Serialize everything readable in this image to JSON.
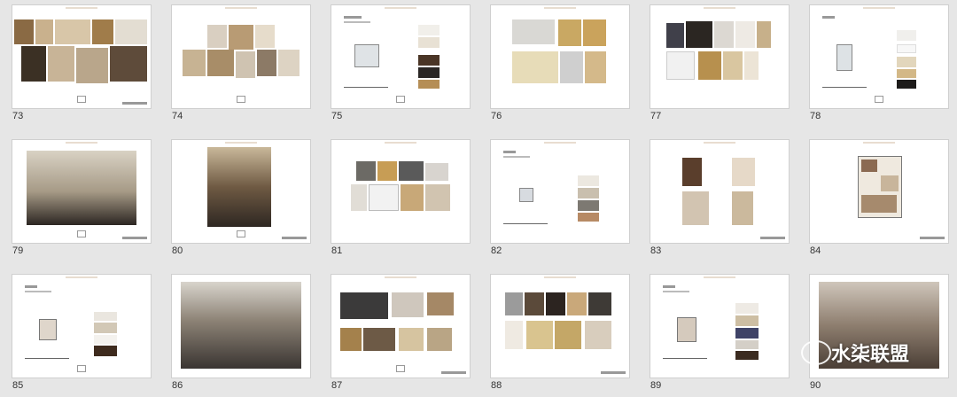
{
  "slides": [
    {
      "number": "73"
    },
    {
      "number": "74"
    },
    {
      "number": "75"
    },
    {
      "number": "76"
    },
    {
      "number": "77"
    },
    {
      "number": "78"
    },
    {
      "number": "79"
    },
    {
      "number": "80"
    },
    {
      "number": "81"
    },
    {
      "number": "82"
    },
    {
      "number": "83"
    },
    {
      "number": "84"
    },
    {
      "number": "85"
    },
    {
      "number": "86"
    },
    {
      "number": "87"
    },
    {
      "number": "88"
    },
    {
      "number": "89"
    },
    {
      "number": "90"
    }
  ],
  "watermark": {
    "text": "水柒联盟"
  },
  "colors": {
    "background": "#e6e6e6",
    "slide": "#ffffff",
    "accent_gold": "#b8955a",
    "dark_wood": "#3a2a1e"
  }
}
